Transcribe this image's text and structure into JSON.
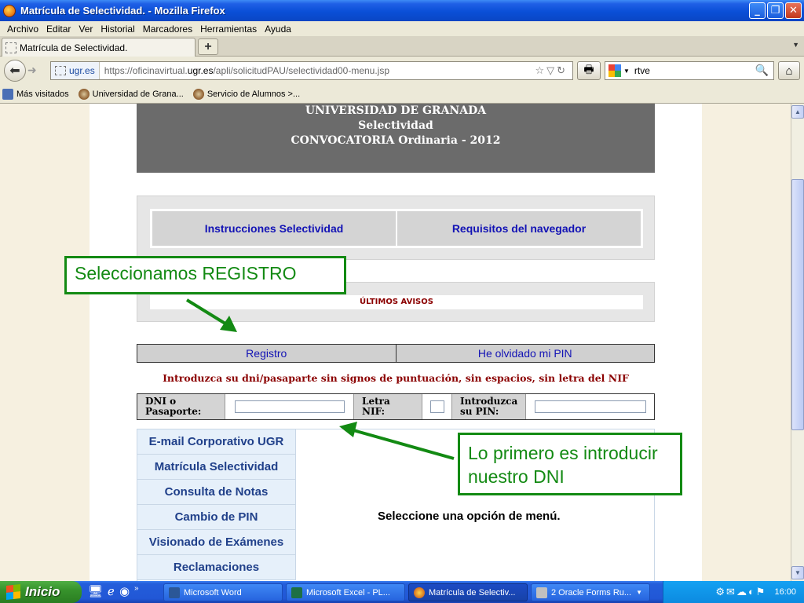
{
  "window": {
    "title": "Matrícula de Selectividad. - Mozilla Firefox",
    "buttons": {
      "minimize": "_",
      "maximize": "❐",
      "close": "✕"
    }
  },
  "menubar": [
    "Archivo",
    "Editar",
    "Ver",
    "Historial",
    "Marcadores",
    "Herramientas",
    "Ayuda"
  ],
  "tabs": {
    "active_tab": "Matrícula de Selectividad.",
    "new_tab": "+"
  },
  "navbar": {
    "identity": "ugr.es",
    "url_prefix": "https://oficinavirtual.",
    "url_domain": "ugr.es",
    "url_path": "/apli/solicitudPAU/selectividad00-menu.jsp",
    "search_value": "rtve"
  },
  "bookmarks": [
    "Más visitados",
    "Universidad de Grana...",
    "Servicio de Alumnos >..."
  ],
  "page": {
    "header": [
      "UNIVERSIDAD DE GRANADA",
      "Selectividad",
      "CONVOCATORIA Ordinaria - 2012"
    ],
    "links": [
      "Instrucciones Selectividad",
      "Requisitos del navegador"
    ],
    "notices_title": "ÚLTIMOS AVISOS",
    "tabs": [
      "Registro",
      "He olvidado mi PIN"
    ],
    "instruction": "Introduzca su dni/pasaparte sin signos de puntuación, sin espacios, sin letra del NIF",
    "form": {
      "dni_label": "DNI o Pasaporte:",
      "letra_label": "Letra NIF:",
      "pin_label": "Introduzca su PIN:",
      "dni_value": "",
      "letra_value": "",
      "pin_value": ""
    },
    "menu": [
      "E-mail Corporativo UGR",
      "Matrícula Selectividad",
      "Consulta de Notas",
      "Cambio de PIN",
      "Visionado de Exámenes",
      "Reclamaciones"
    ],
    "menu_message": "Seleccione una opción de menú."
  },
  "annotations": {
    "callout_registro": "Seleccionamos REGISTRO",
    "callout_dni": "Lo primero es introducir nuestro DNI",
    "color": "#138a13"
  },
  "taskbar": {
    "start": "Inicio",
    "tasks": [
      "Microsoft Word",
      "Microsoft Excel - PL...",
      "Matrícula de Selectiv...",
      "2 Oracle Forms Ru..."
    ],
    "clock": "16:00"
  }
}
